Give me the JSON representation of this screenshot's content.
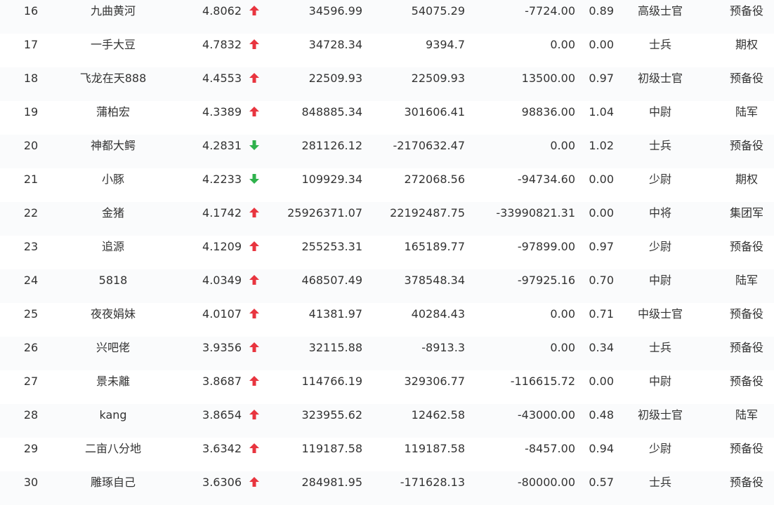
{
  "colors": {
    "up": "#e8353f",
    "down": "#2fb24c"
  },
  "rows": [
    {
      "rank": "16",
      "name": "九曲黄河",
      "score": "4.8062",
      "trend": "up",
      "v1": "34596.99",
      "v2": "54075.29",
      "v3": "-7724.00",
      "ratio": "0.89",
      "rank_name": "高级士官",
      "type": "预备役"
    },
    {
      "rank": "17",
      "name": "一手大豆",
      "score": "4.7832",
      "trend": "up",
      "v1": "34728.34",
      "v2": "9394.7",
      "v3": "0.00",
      "ratio": "0.00",
      "rank_name": "士兵",
      "type": "期权"
    },
    {
      "rank": "18",
      "name": "飞龙在天888",
      "score": "4.4553",
      "trend": "up",
      "v1": "22509.93",
      "v2": "22509.93",
      "v3": "13500.00",
      "ratio": "0.97",
      "rank_name": "初级士官",
      "type": "预备役"
    },
    {
      "rank": "19",
      "name": "蒲柏宏",
      "score": "4.3389",
      "trend": "up",
      "v1": "848885.34",
      "v2": "301606.41",
      "v3": "98836.00",
      "ratio": "1.04",
      "rank_name": "中尉",
      "type": "陆军"
    },
    {
      "rank": "20",
      "name": "神都大鳄",
      "score": "4.2831",
      "trend": "down",
      "v1": "281126.12",
      "v2": "-2170632.47",
      "v3": "0.00",
      "ratio": "1.02",
      "rank_name": "士兵",
      "type": "预备役"
    },
    {
      "rank": "21",
      "name": "小豚",
      "score": "4.2233",
      "trend": "down",
      "v1": "109929.34",
      "v2": "272068.56",
      "v3": "-94734.60",
      "ratio": "0.00",
      "rank_name": "少尉",
      "type": "期权"
    },
    {
      "rank": "22",
      "name": "金猪",
      "score": "4.1742",
      "trend": "up",
      "v1": "25926371.07",
      "v2": "22192487.75",
      "v3": "-33990821.31",
      "ratio": "0.00",
      "rank_name": "中将",
      "type": "集团军"
    },
    {
      "rank": "23",
      "name": "追源",
      "score": "4.1209",
      "trend": "up",
      "v1": "255253.31",
      "v2": "165189.77",
      "v3": "-97899.00",
      "ratio": "0.97",
      "rank_name": "少尉",
      "type": "预备役"
    },
    {
      "rank": "24",
      "name": "5818",
      "score": "4.0349",
      "trend": "up",
      "v1": "468507.49",
      "v2": "378548.34",
      "v3": "-97925.16",
      "ratio": "0.70",
      "rank_name": "中尉",
      "type": "陆军"
    },
    {
      "rank": "25",
      "name": "夜夜娟妹",
      "score": "4.0107",
      "trend": "up",
      "v1": "41381.97",
      "v2": "40284.43",
      "v3": "0.00",
      "ratio": "0.71",
      "rank_name": "中级士官",
      "type": "预备役"
    },
    {
      "rank": "26",
      "name": "兴吧佬",
      "score": "3.9356",
      "trend": "up",
      "v1": "32115.88",
      "v2": "-8913.3",
      "v3": "0.00",
      "ratio": "0.34",
      "rank_name": "士兵",
      "type": "预备役"
    },
    {
      "rank": "27",
      "name": "景未離",
      "score": "3.8687",
      "trend": "up",
      "v1": "114766.19",
      "v2": "329306.77",
      "v3": "-116615.72",
      "ratio": "0.00",
      "rank_name": "中尉",
      "type": "预备役"
    },
    {
      "rank": "28",
      "name": "kang",
      "score": "3.8654",
      "trend": "up",
      "v1": "323955.62",
      "v2": "12462.58",
      "v3": "-43000.00",
      "ratio": "0.48",
      "rank_name": "初级士官",
      "type": "陆军"
    },
    {
      "rank": "29",
      "name": "二亩八分地",
      "score": "3.6342",
      "trend": "up",
      "v1": "119187.58",
      "v2": "119187.58",
      "v3": "-8457.00",
      "ratio": "0.94",
      "rank_name": "少尉",
      "type": "预备役"
    },
    {
      "rank": "30",
      "name": "雕琢自己",
      "score": "3.6306",
      "trend": "up",
      "v1": "284981.95",
      "v2": "-171628.13",
      "v3": "-80000.00",
      "ratio": "0.57",
      "rank_name": "士兵",
      "type": "预备役"
    }
  ]
}
